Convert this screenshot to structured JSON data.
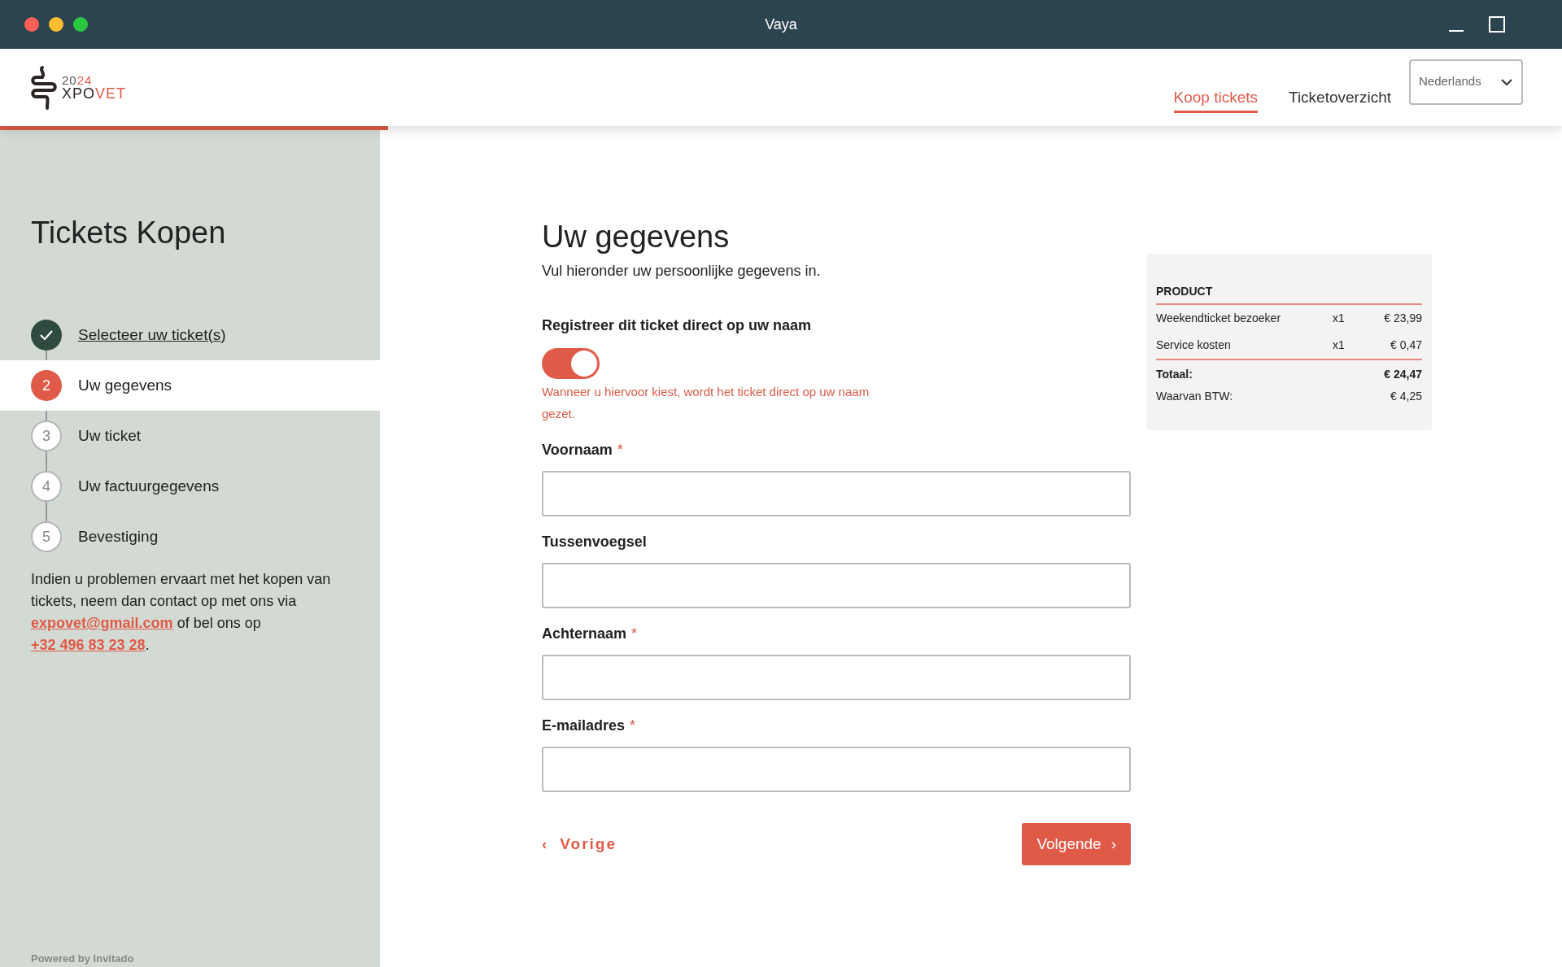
{
  "window": {
    "title": "Vaya"
  },
  "logo": {
    "year": [
      "20",
      "24"
    ],
    "name": [
      "XPO",
      "VET"
    ]
  },
  "nav": [
    {
      "label": "Koop tickets",
      "selected": true
    },
    {
      "label": "Ticketoverzicht",
      "selected": false
    }
  ],
  "language": {
    "value": "Nederlands"
  },
  "sidebar": {
    "title": "Tickets Kopen",
    "steps": [
      {
        "label": "Selecteer uw ticket(s)",
        "kind": "done"
      },
      {
        "number": "2",
        "label": "Uw gegevens",
        "kind": "active"
      },
      {
        "number": "3",
        "label": "Uw ticket",
        "kind": "pending"
      },
      {
        "number": "4",
        "label": "Uw factuurgegevens",
        "kind": "pending"
      },
      {
        "number": "5",
        "label": "Bevestiging",
        "kind": "pending"
      }
    ],
    "help": {
      "before": "Indien u problemen ervaart met het kopen van tickets, neem dan contact op met ons via",
      "email": "expovet@gmail.com",
      "middle": "of bel ons op",
      "phone": "+32 496 83 23 28",
      "after": "."
    },
    "footer": "Powered by Invitado"
  },
  "form": {
    "title": "Uw gegevens",
    "subtitle": "Vul hieronder uw persoonlijke gegevens in.",
    "toggle": {
      "label": "Registreer dit ticket direct op uw naam",
      "on": true,
      "hint": "Wanneer u hiervoor kiest, wordt het ticket direct op uw naam gezet."
    },
    "fields": [
      {
        "label": "Voornaam",
        "required_mark": "*"
      },
      {
        "label": "Tussenvoegsel"
      },
      {
        "label": "Achternaam",
        "required_mark": "*"
      },
      {
        "label": "E-mailadres",
        "required_mark": "*"
      }
    ],
    "back": {
      "icon": "‹",
      "label": "Vorige"
    },
    "next": {
      "label": "Volgende",
      "icon": "›"
    }
  },
  "summary": {
    "heading": "PRODUCT",
    "rows": [
      {
        "name": "Weekendticket bezoeker",
        "qty": "x1",
        "price": "€ 23,99"
      },
      {
        "name": "Service kosten",
        "qty": "x1",
        "price": "€ 0,47"
      }
    ],
    "total": {
      "label": "Totaal:",
      "value": "€ 24,47"
    },
    "vat": {
      "label": "Waarvan BTW:",
      "value": "€ 4,25"
    }
  }
}
